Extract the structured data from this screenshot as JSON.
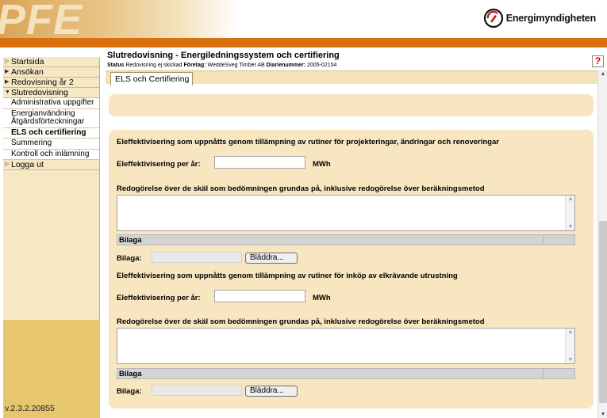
{
  "header": {
    "logo_text": "PFE",
    "brand_name": "Energimyndigheten"
  },
  "sidebar": {
    "items": [
      {
        "label": "Startsida",
        "expanded": false
      },
      {
        "label": "Ansökan",
        "expanded": false
      },
      {
        "label": "Redovisning år 2",
        "expanded": false
      },
      {
        "label": "Slutredovisning",
        "expanded": true
      }
    ],
    "sub_items": [
      {
        "label": "Administrativa uppgifter"
      },
      {
        "label": "Energianvändning Åtgärdsförteckningar"
      },
      {
        "label": "ELS och certifiering",
        "active": true
      },
      {
        "label": "Summering"
      },
      {
        "label": "Kontroll och inlämning"
      }
    ],
    "logout": "Logga ut",
    "version": "v.2.3.2.20855"
  },
  "page": {
    "title": "Slutredovisning - Energiledningssystem och certifiering",
    "status_label": "Status",
    "status_value": "Redovisning ej skickad",
    "company_label": "Företag:",
    "company_value": "WeddeSveg Timber AB",
    "diary_label": "Diarienummer:",
    "diary_value": "2005-02154",
    "help": "?",
    "tab": "ELS och Certifiering"
  },
  "sections": [
    {
      "heading": "Eleffektivisering som uppnåtts genom tillämpning av rutiner för projekteringar, ändringar och renoveringar",
      "field_label": "Eleffektivisering per år:",
      "field_value": "",
      "unit": "MWh",
      "reason_label": "Redogörelse över de skäl som bedömningen grundas på, inklusive redogörelse över beräkningsmetod",
      "reason_value": "",
      "attachment_header": "Bilaga",
      "attachment_label": "Bilaga:",
      "browse_label": "Bläddra..."
    },
    {
      "heading": "Eleffektivisering som uppnåtts genom tillämpning av rutiner för inköp av elkrävande utrustning",
      "field_label": "Eleffektivisering per år:",
      "field_value": "",
      "unit": "MWh",
      "reason_label": "Redogörelse över de skäl som bedömningen grundas på, inklusive redogörelse över beräkningsmetod",
      "reason_value": "",
      "attachment_header": "Bilaga",
      "attachment_label": "Bilaga:",
      "browse_label": "Bläddra..."
    }
  ],
  "colors": {
    "accent": "#d9700e",
    "panel": "#f7e6bf",
    "sidebar": "#f6e8c4"
  }
}
